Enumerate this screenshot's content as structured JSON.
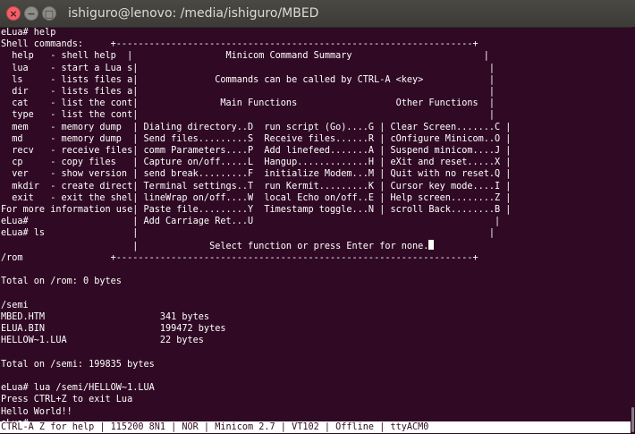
{
  "window": {
    "title": "ishiguro@lenovo: /media/ishiguro/MBED",
    "close_glyph": "×",
    "minimize_glyph": "−",
    "maximize_glyph": "□"
  },
  "terminal": {
    "lines": [
      "eLua# help",
      "Shell commands:     +-----------------------------------------------------------------+",
      "  help   - shell help  |                 Minicom Command Summary                        |",
      "  lua    - start a Lua s|                                                                |",
      "  ls     - lists files a|              Commands can be called by CTRL-A <key>            |",
      "  dir    - lists files a|                                                                |",
      "  cat    - list the cont|               Main Functions                  Other Functions  |",
      "  type   - list the cont|                                                                |",
      "  mem    - memory dump  | Dialing directory..D  run script (Go)....G | Clear Screen.......C |",
      "  md     - memory dump  | Send files.........S  Receive files......R | cOnfigure Minicom..O |",
      "  recv   - receive files| comm Parameters....P  Add linefeed.......A | Suspend minicom....J |",
      "  cp     - copy files   | Capture on/off.....L  Hangup.............H | eXit and reset.....X |",
      "  ver    - show version | send break.........F  initialize Modem...M | Quit with no reset.Q |",
      "  mkdir  - create direct| Terminal settings..T  run Kermit.........K | Cursor key mode....I |",
      "  exit   - exit the shel| lineWrap on/off....W  local Echo on/off..E | Help screen........Z |",
      "For more information use| Paste file.........Y  Timestamp toggle...N | scroll Back........B |",
      "eLua#                   | Add Carriage Ret...U                                            |",
      "eLua# ls                |                                                                |",
      "                        |             Select function or press Enter for none.",
      "/rom                +-----------------------------------------------------------------+",
      "",
      "Total on /rom: 0 bytes",
      "",
      "/semi",
      "MBED.HTM                     341 bytes",
      "ELUA.BIN                     199472 bytes",
      "HELLOW~1.LUA                 22 bytes",
      "",
      "Total on /semi: 199835 bytes",
      "",
      "eLua# lua /semi/HELLOW~1.LUA",
      "Press CTRL+Z to exit Lua",
      "Hello World!!",
      "eLua# "
    ]
  },
  "status_bar": {
    "text": "CTRL-A Z for help | 115200 8N1 | NOR | Minicom 2.7 | VT102 | Offline | ttyACM0"
  }
}
